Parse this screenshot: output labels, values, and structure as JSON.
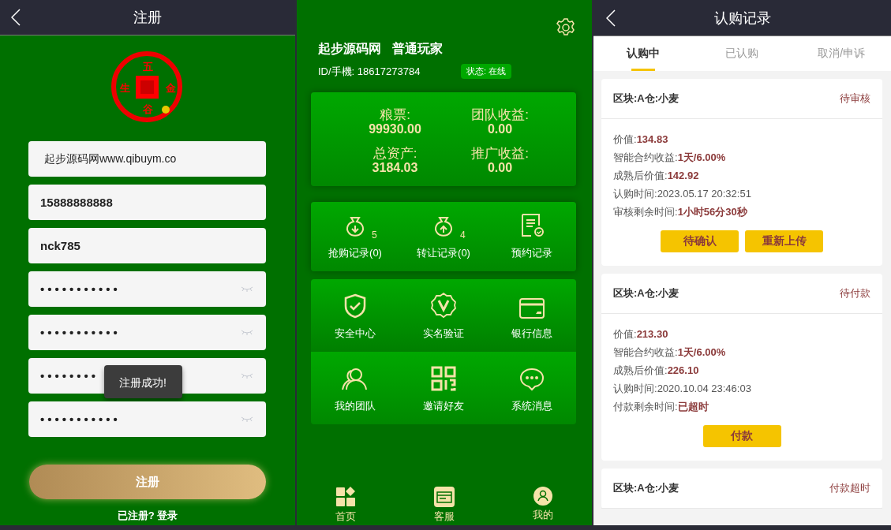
{
  "register": {
    "title": "注册",
    "logo_chars": [
      "五",
      "金",
      "谷",
      "生"
    ],
    "fields": [
      {
        "kind": "text",
        "value": "起步源码网www.qibuym.co",
        "strong": false
      },
      {
        "kind": "text",
        "value": "15888888888",
        "strong": true
      },
      {
        "kind": "text",
        "value": "nck785",
        "strong": true
      },
      {
        "kind": "password",
        "value": "•••••••••••",
        "strong": true
      },
      {
        "kind": "password",
        "value": "•••••••••••",
        "strong": true
      },
      {
        "kind": "password",
        "value": "••••••••",
        "strong": true
      },
      {
        "kind": "password",
        "value": "•••••••••••",
        "strong": true
      }
    ],
    "toast": "注册成功!",
    "submit": "注册",
    "login_link": "已注册? 登录"
  },
  "profile": {
    "name": "起步源码网",
    "role": "普通玩家",
    "id_line": "ID/手機: 18617273784",
    "status": "状态: 在线",
    "stats": [
      {
        "label": "粮票:",
        "value": "99930.00"
      },
      {
        "label": "团队收益:",
        "value": "0.00"
      },
      {
        "label": "总资产:",
        "value": "3184.03"
      },
      {
        "label": "推广收益:",
        "value": "0.00"
      }
    ],
    "records": [
      {
        "label": "抢购记录(0)",
        "count": "5"
      },
      {
        "label": "转让记录(0)",
        "count": "4"
      },
      {
        "label": "预约记录"
      }
    ],
    "menu": [
      {
        "label": "安全中心"
      },
      {
        "label": "实名验证"
      },
      {
        "label": "银行信息"
      },
      {
        "label": "我的团队"
      },
      {
        "label": "邀请好友"
      },
      {
        "label": "系统消息"
      }
    ],
    "nav": [
      {
        "label": "首页"
      },
      {
        "label": "客服"
      },
      {
        "label": "我的"
      }
    ]
  },
  "orders": {
    "title": "认购记录",
    "tabs": [
      {
        "label": "认购中",
        "selected": true
      },
      {
        "label": "已认购",
        "selected": false
      },
      {
        "label": "取消/申诉",
        "selected": false
      }
    ],
    "cards": [
      {
        "block": "区块:A仓:小麦",
        "status": "待审核",
        "lines": [
          {
            "label": "价值:",
            "value": "134.83",
            "emphasis": true
          },
          {
            "label": "智能合约收益:",
            "value": "1天/6.00%",
            "emphasis": true
          },
          {
            "label": "成熟后价值:",
            "value": "142.92",
            "emphasis": true
          },
          {
            "label": "认购时间:",
            "value": "2023.05.17 20:32:51",
            "emphasis": false
          },
          {
            "label": "审核剩余时间:",
            "value": "1小时56分30秒",
            "emphasis": true
          }
        ],
        "buttons": [
          "待确认",
          "重新上传"
        ]
      },
      {
        "block": "区块:A仓:小麦",
        "status": "待付款",
        "lines": [
          {
            "label": "价值:",
            "value": "213.30",
            "emphasis": true
          },
          {
            "label": "智能合约收益:",
            "value": "1天/6.00%",
            "emphasis": true
          },
          {
            "label": "成熟后价值:",
            "value": "226.10",
            "emphasis": true
          },
          {
            "label": "认购时间:",
            "value": "2020.10.04 23:46:03",
            "emphasis": false
          },
          {
            "label": "付款剩余时间:",
            "value": "已超时",
            "emphasis": true
          }
        ],
        "buttons": [
          "付款"
        ]
      },
      {
        "block": "区块:A仓:小麦",
        "status": "付款超时"
      }
    ]
  }
}
